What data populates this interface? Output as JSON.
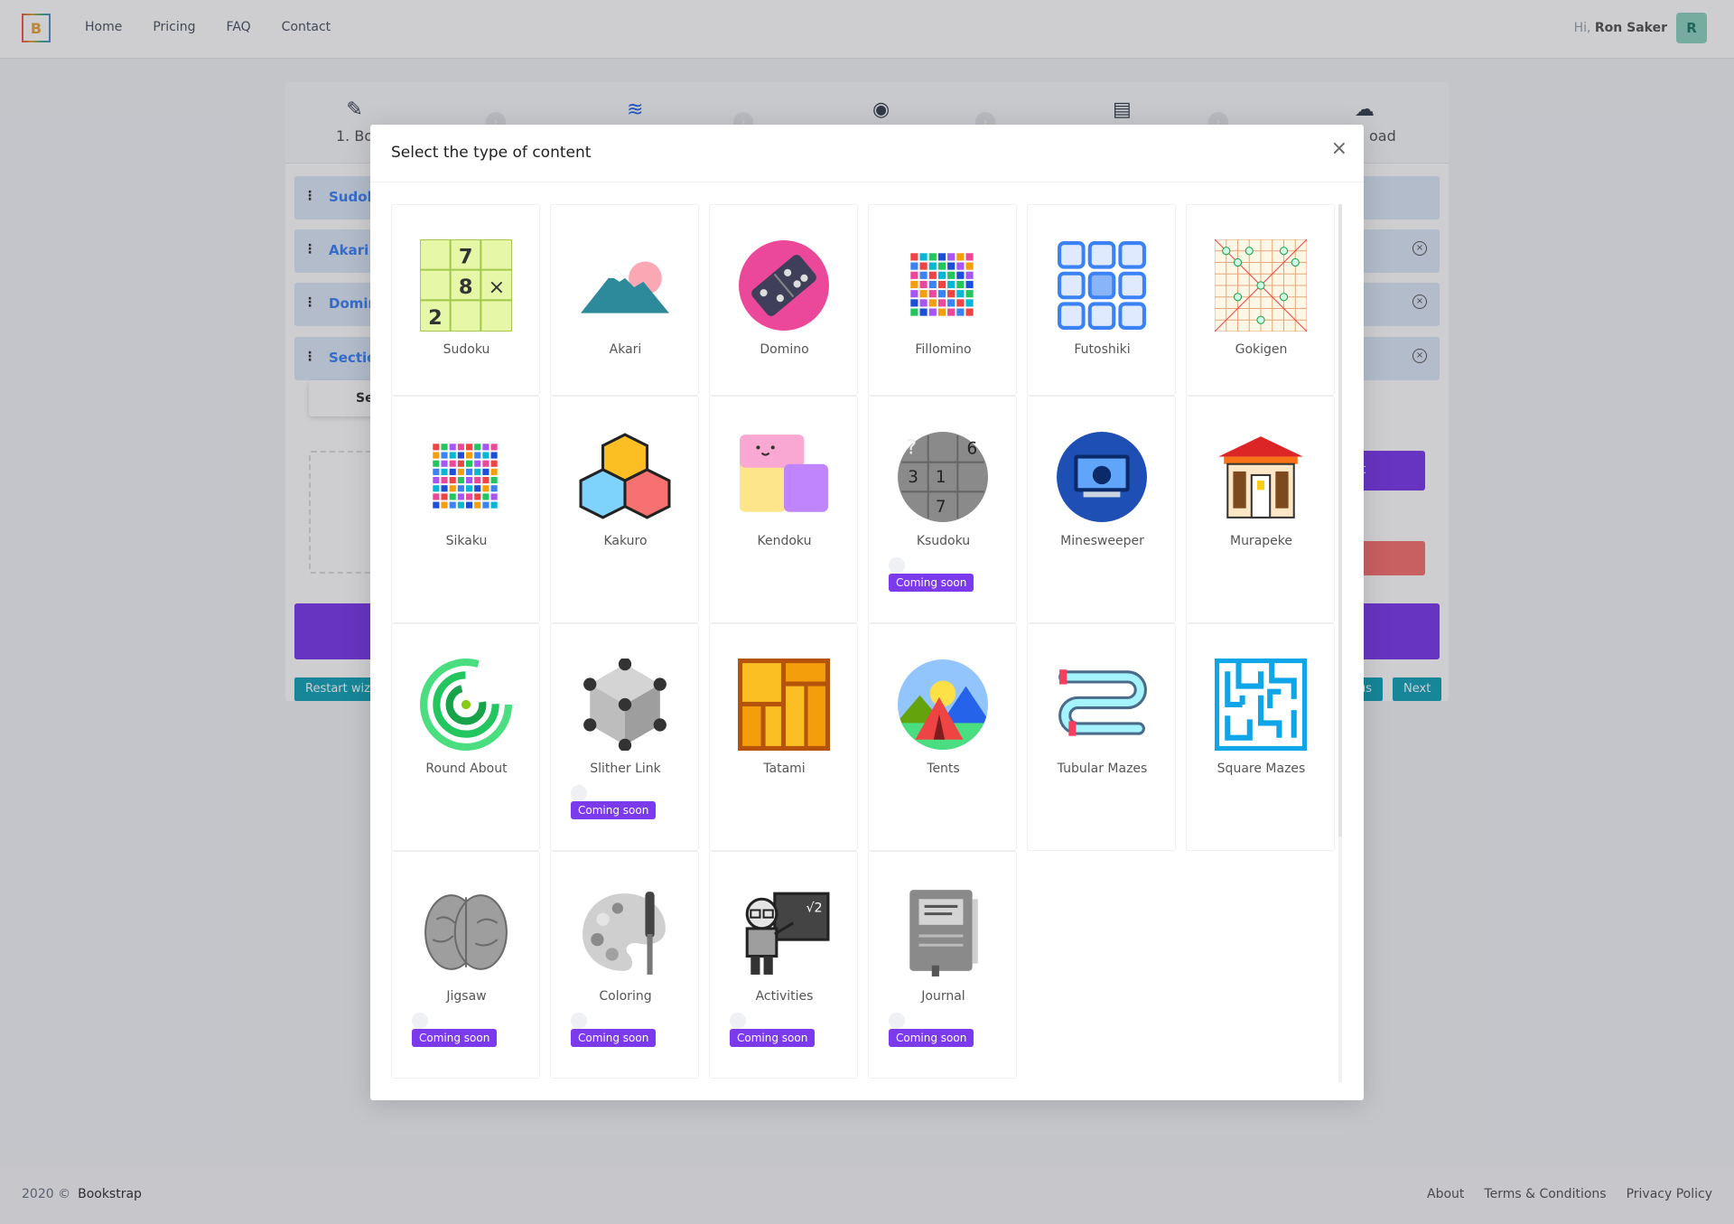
{
  "nav": {
    "logo_letter": "B",
    "links": [
      "Home",
      "Pricing",
      "FAQ",
      "Contact"
    ],
    "greeting": "Hi,",
    "user_name": "Ron Saker",
    "avatar_letter": "R"
  },
  "wizard": {
    "steps": [
      {
        "label": "1. Bo",
        "icon": "pencil-ruler-icon"
      },
      {
        "label": "",
        "icon": "layers-icon"
      },
      {
        "label": "",
        "icon": "eye-icon"
      },
      {
        "label": "",
        "icon": "document-icon"
      },
      {
        "label": "oad",
        "icon": "cloud-download-icon"
      }
    ],
    "sections": [
      "Sudok",
      "Akari",
      "Domin",
      "Sectio"
    ],
    "sub_label": "Se",
    "restart_label": "Restart wiza",
    "previous_label": "ous",
    "next_label": "Next",
    "add_label": "nt"
  },
  "modal": {
    "title": "Select the type of content",
    "coming_soon_label": "Coming soon",
    "items": [
      {
        "name": "Sudoku",
        "icon": "sudoku-icon",
        "coming_soon": false
      },
      {
        "name": "Akari",
        "icon": "mountain-sun-icon",
        "coming_soon": false
      },
      {
        "name": "Domino",
        "icon": "domino-icon",
        "coming_soon": false
      },
      {
        "name": "Fillomino",
        "icon": "color-grid-icon",
        "coming_soon": false
      },
      {
        "name": "Futoshiki",
        "icon": "linked-squares-icon",
        "coming_soon": false
      },
      {
        "name": "Gokigen",
        "icon": "diagonal-grid-icon",
        "coming_soon": false
      },
      {
        "name": "Sikaku",
        "icon": "pixel-grid-icon",
        "coming_soon": false
      },
      {
        "name": "Kakuro",
        "icon": "cubes-icon",
        "coming_soon": false
      },
      {
        "name": "Kendoku",
        "icon": "blocks-icon",
        "coming_soon": false
      },
      {
        "name": "Ksudoku",
        "icon": "ksudoku-icon",
        "coming_soon": true
      },
      {
        "name": "Minesweeper",
        "icon": "mine-monitor-icon",
        "coming_soon": false
      },
      {
        "name": "Murapeke",
        "icon": "temple-icon",
        "coming_soon": false
      },
      {
        "name": "Round About",
        "icon": "circular-maze-icon",
        "coming_soon": false
      },
      {
        "name": "Slither Link",
        "icon": "hexagon-nodes-icon",
        "coming_soon": true
      },
      {
        "name": "Tatami",
        "icon": "tatami-icon",
        "coming_soon": false
      },
      {
        "name": "Tents",
        "icon": "tent-icon",
        "coming_soon": false
      },
      {
        "name": "Tubular Mazes",
        "icon": "tube-maze-icon",
        "coming_soon": false
      },
      {
        "name": "Square Mazes",
        "icon": "square-maze-icon",
        "coming_soon": false
      },
      {
        "name": "Jigsaw",
        "icon": "brain-icon",
        "coming_soon": true
      },
      {
        "name": "Coloring",
        "icon": "palette-icon",
        "coming_soon": true
      },
      {
        "name": "Activities",
        "icon": "teacher-icon",
        "coming_soon": true
      },
      {
        "name": "Journal",
        "icon": "notebook-icon",
        "coming_soon": true
      }
    ]
  },
  "footer": {
    "copyright": "2020 ©",
    "brand": "Bookstrap",
    "links": [
      "About",
      "Terms & Conditions",
      "Privacy Policy"
    ]
  }
}
